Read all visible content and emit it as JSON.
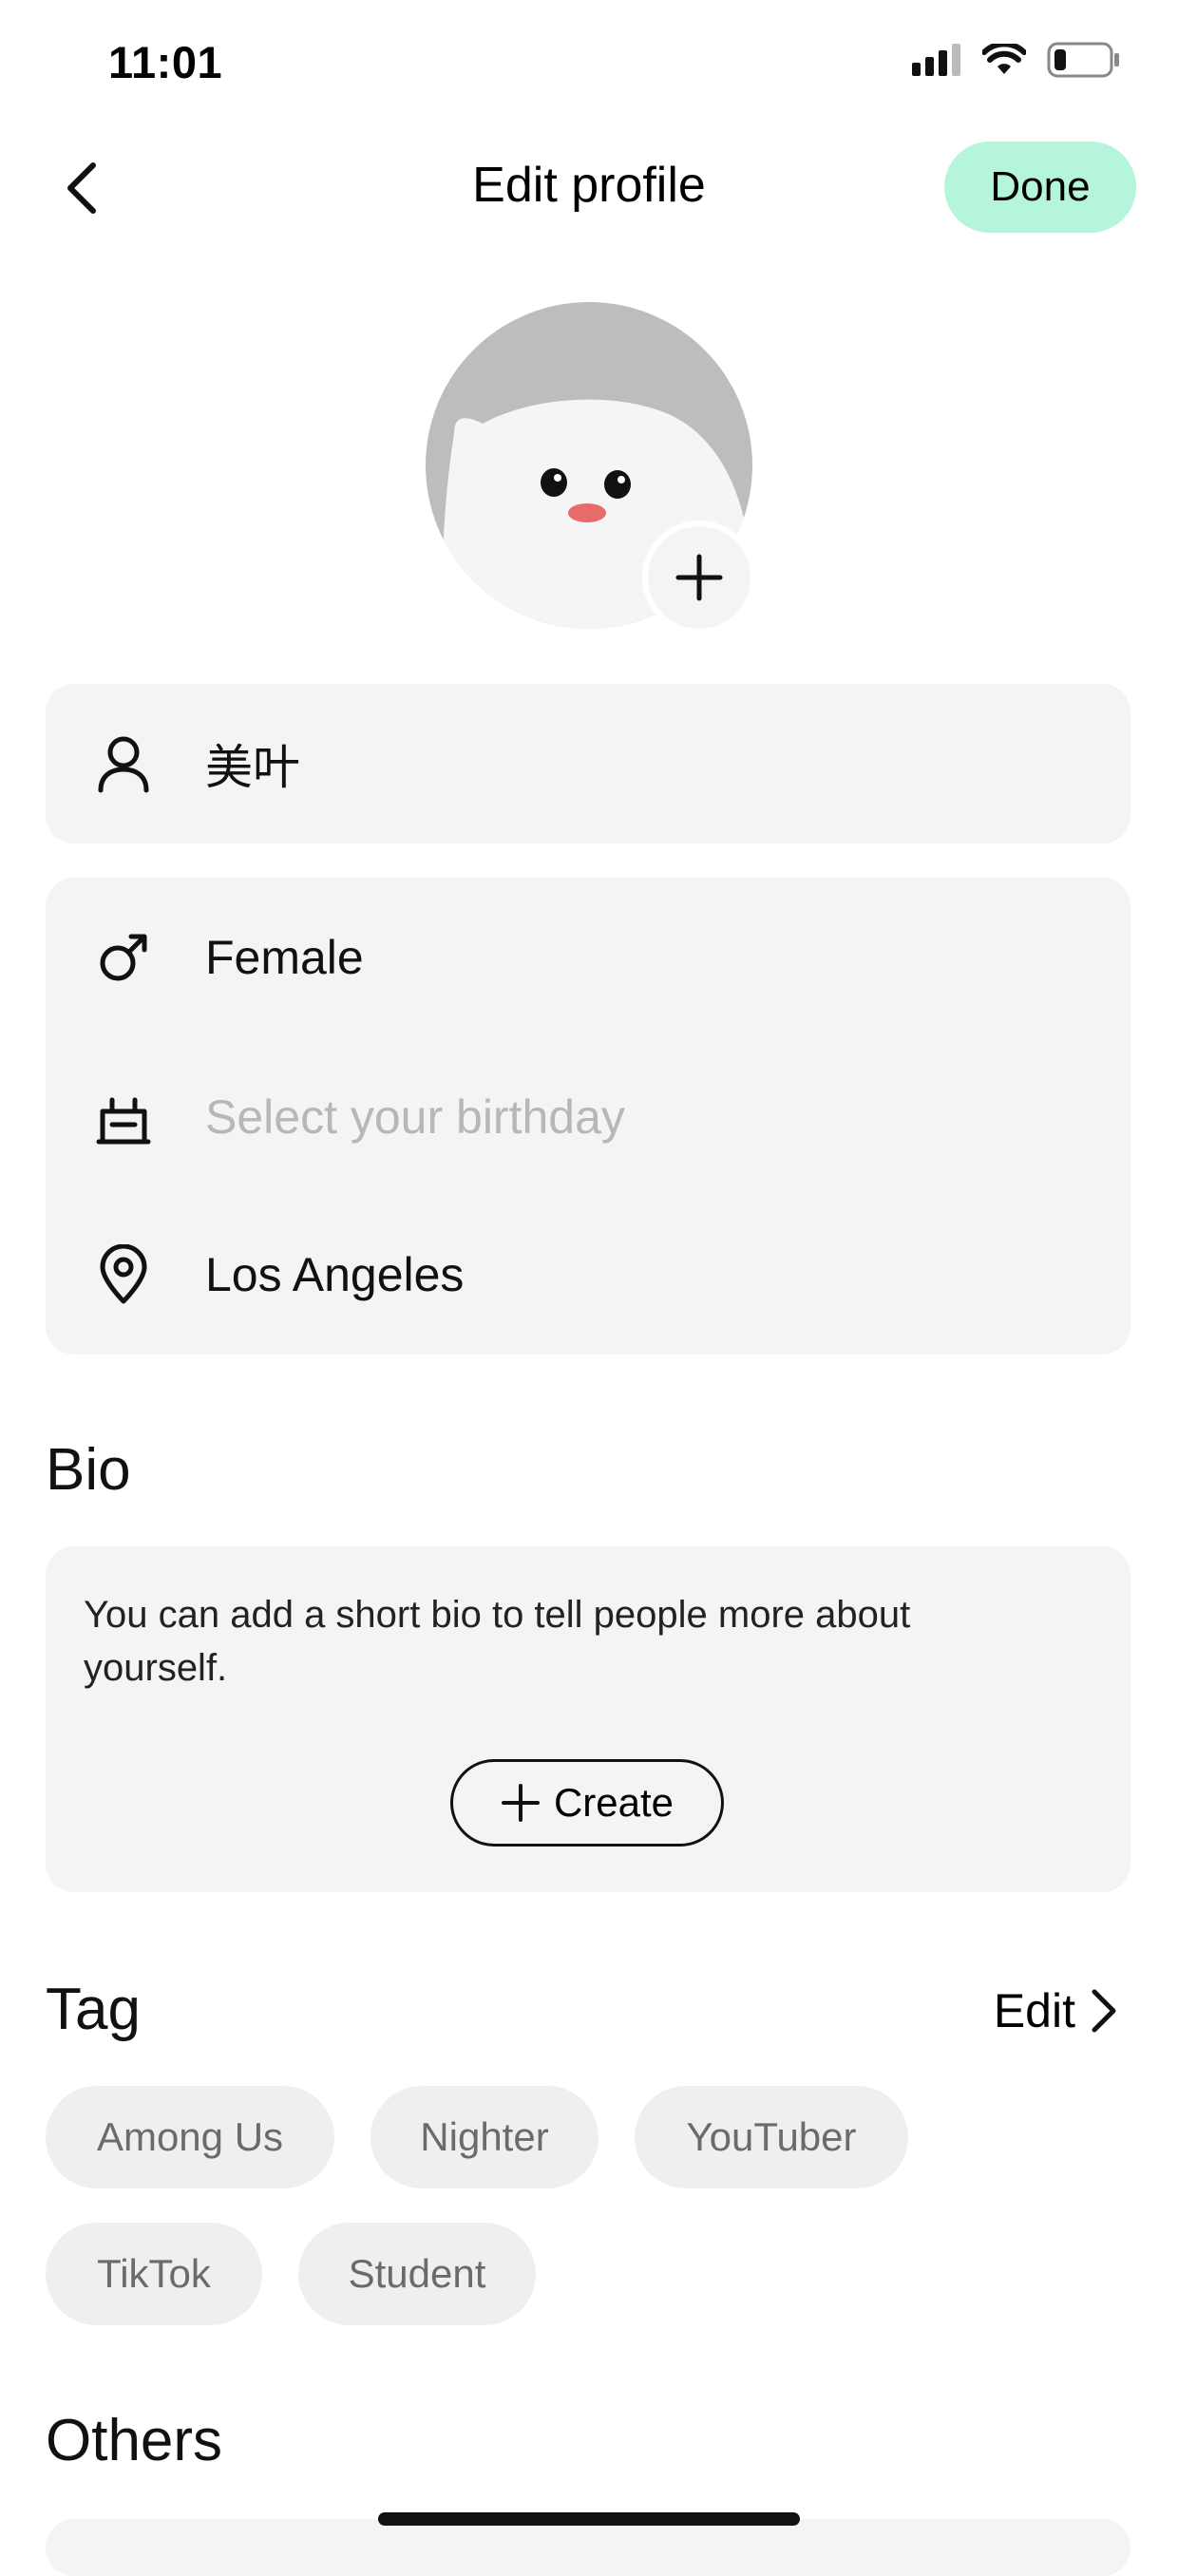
{
  "status_bar": {
    "time": "11:01"
  },
  "header": {
    "title": "Edit profile",
    "done_label": "Done"
  },
  "profile": {
    "name": "美叶",
    "gender": "Female",
    "birthday_placeholder": "Select your birthday",
    "location": "Los Angeles"
  },
  "bio": {
    "heading": "Bio",
    "description": "You can add a short bio to tell people more about yourself.",
    "create_label": "Create"
  },
  "tags": {
    "heading": "Tag",
    "edit_label": "Edit",
    "items": [
      "Among Us",
      "Nighter",
      "YouTuber",
      "TikTok",
      "Student"
    ]
  },
  "others": {
    "heading": "Others"
  },
  "colors": {
    "accent": "#b5f5dc",
    "card_bg": "#f4f4f4",
    "placeholder": "#b7b7b7",
    "avatar_bg": "#bdbdbd"
  },
  "icons": [
    "back-icon",
    "add-icon",
    "person-icon",
    "male-symbol-icon",
    "cake-icon",
    "location-pin-icon",
    "chevron-right-icon"
  ]
}
